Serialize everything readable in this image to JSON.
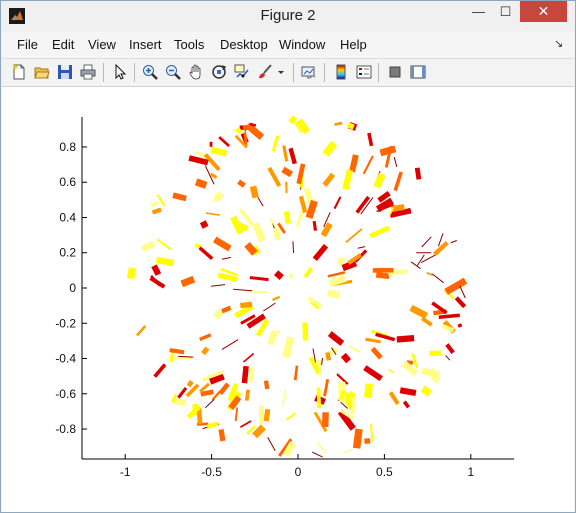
{
  "window": {
    "title": "Figure 2",
    "controls": {
      "minimize": "—",
      "maximize": "☐",
      "close": "✕"
    }
  },
  "menubar": {
    "items": [
      "File",
      "Edit",
      "View",
      "Insert",
      "Tools",
      "Desktop",
      "Window",
      "Help"
    ]
  },
  "toolbar": {
    "buttons": [
      "new-figure-icon",
      "open-file-icon",
      "save-icon",
      "print-icon",
      "edit-plot-arrow-icon",
      "zoom-in-icon",
      "zoom-out-icon",
      "pan-hand-icon",
      "rotate-3d-icon",
      "data-cursor-icon",
      "brush-icon",
      "brush-dropdown-icon",
      "link-plot-icon",
      "insert-colorbar-icon",
      "insert-legend-icon",
      "hide-plot-tools-icon",
      "show-plot-tools-icon"
    ]
  },
  "chart_data": {
    "type": "scatter",
    "description_of_marks": "radial short line segments with varying widths",
    "xlim": [
      -1.25,
      1.25
    ],
    "ylim": [
      -0.97,
      0.97
    ],
    "xticks": [
      -1,
      -0.5,
      0,
      0.5,
      1
    ],
    "xtick_labels": [
      "-1",
      "-0.5",
      "0",
      "0.5",
      "1"
    ],
    "yticks": [
      -0.8,
      -0.6,
      -0.4,
      -0.2,
      0,
      0.2,
      0.4,
      0.6,
      0.8
    ],
    "ytick_labels": [
      "-0.8",
      "-0.6",
      "-0.4",
      "-0.2",
      "0",
      "0.2",
      "0.4",
      "0.6",
      "0.8"
    ],
    "colors": [
      "#ffff00",
      "#ffff88",
      "#ff9900",
      "#ff6600",
      "#dd0000",
      "#880000"
    ],
    "segment_count": 260,
    "radius_max": 0.97,
    "grid": false,
    "box": "off"
  }
}
